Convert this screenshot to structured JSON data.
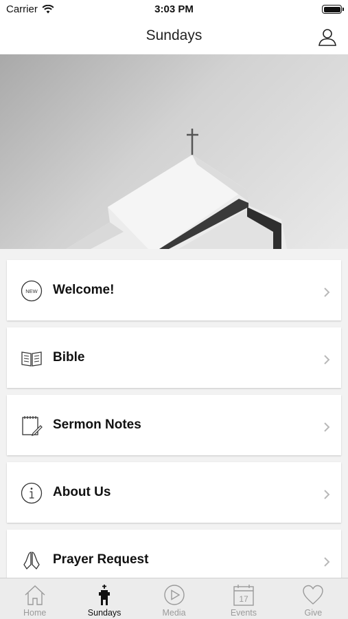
{
  "status_bar": {
    "carrier": "Carrier",
    "time": "3:03 PM"
  },
  "nav": {
    "title": "Sundays",
    "profile_icon": "person-icon"
  },
  "menu": [
    {
      "label": "Welcome!",
      "icon": "new-badge-icon",
      "badge_text": "NEW"
    },
    {
      "label": "Bible",
      "icon": "book-icon"
    },
    {
      "label": "Sermon Notes",
      "icon": "notepad-pencil-icon"
    },
    {
      "label": "About Us",
      "icon": "info-icon"
    },
    {
      "label": "Prayer Request",
      "icon": "praying-hands-icon"
    }
  ],
  "tabs": [
    {
      "label": "Home",
      "icon": "home-icon",
      "active": false
    },
    {
      "label": "Sundays",
      "icon": "church-icon",
      "active": true
    },
    {
      "label": "Media",
      "icon": "play-icon",
      "active": false
    },
    {
      "label": "Events",
      "icon": "calendar-icon",
      "active": false,
      "calendar_day": "17"
    },
    {
      "label": "Give",
      "icon": "heart-icon",
      "active": false
    }
  ],
  "colors": {
    "active_tab": "#111111",
    "inactive_tab": "#9a9a9a",
    "tab_bar_bg": "#ececec",
    "page_bg": "#f2f2f2"
  }
}
